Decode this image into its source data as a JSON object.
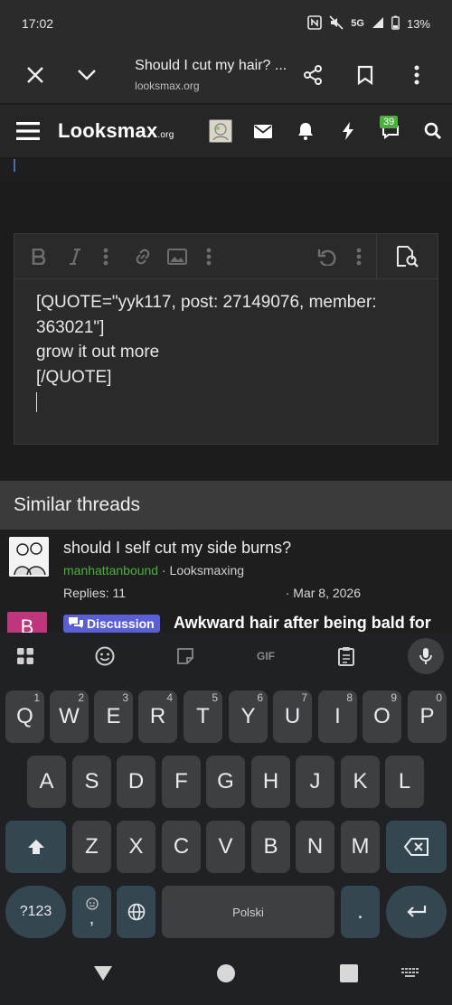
{
  "status_bar": {
    "time": "17:02",
    "network": "5G",
    "battery": "13%"
  },
  "browser": {
    "title": "Should I cut my hair? ...",
    "url": "looksmax.org"
  },
  "site": {
    "logo_main": "Looksmax",
    "logo_suffix": ".org",
    "chat_badge": "39"
  },
  "editor": {
    "lines": [
      "[QUOTE=\"yyk117, post: 27149076, member:",
      "363021\"]",
      "grow it out more",
      "[/QUOTE]"
    ]
  },
  "similar": {
    "heading": "Similar threads",
    "thread1": {
      "title": "should I self cut my side burns?",
      "author": "manhattanbound",
      "forum": " · Looksmaxing",
      "replies": "Replies: 11",
      "date": "· Mar 8, 2026"
    },
    "thread2": {
      "avatar_letter": "B",
      "tag": "Discussion",
      "title": "Awkward hair after being bald for"
    }
  },
  "keyboard": {
    "toolbar": {
      "gif": "GIF"
    },
    "row1": [
      {
        "k": "Q",
        "h": "1"
      },
      {
        "k": "W",
        "h": "2"
      },
      {
        "k": "E",
        "h": "3"
      },
      {
        "k": "R",
        "h": "4"
      },
      {
        "k": "T",
        "h": "5"
      },
      {
        "k": "Y",
        "h": "6"
      },
      {
        "k": "U",
        "h": "7"
      },
      {
        "k": "I",
        "h": "8"
      },
      {
        "k": "O",
        "h": "9"
      },
      {
        "k": "P",
        "h": "0"
      }
    ],
    "row2": [
      "A",
      "S",
      "D",
      "F",
      "G",
      "H",
      "J",
      "K",
      "L"
    ],
    "row3": [
      "Z",
      "X",
      "C",
      "V",
      "B",
      "N",
      "M"
    ],
    "sym_label": "?123",
    "comma": ",",
    "space_label": "Polski",
    "period": "."
  }
}
